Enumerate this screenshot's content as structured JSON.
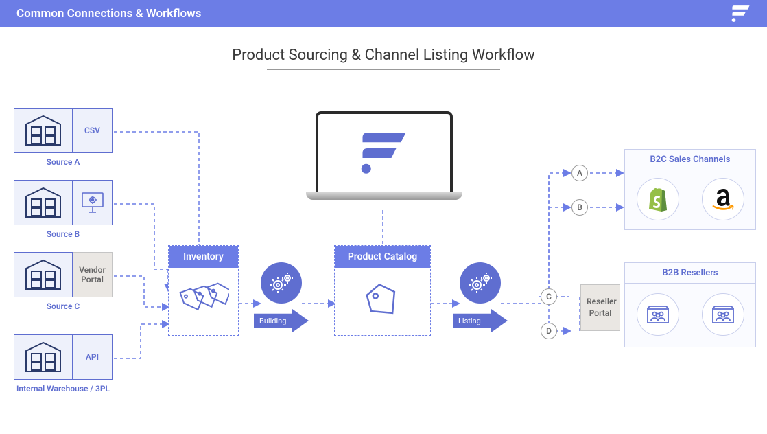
{
  "header": {
    "title": "Common Connections & Workflows"
  },
  "diagram_title": "Product Sourcing & Channel Listing Workflow",
  "sources": [
    {
      "caption": "Source A",
      "tag": "CSV",
      "tag_type": "std"
    },
    {
      "caption": "Source B",
      "tag": "",
      "tag_type": "monitor"
    },
    {
      "caption": "Source C",
      "tag": "Vendor Portal",
      "tag_type": "vendor"
    },
    {
      "caption": "Internal Warehouse / 3PL",
      "tag": "API",
      "tag_type": "std"
    }
  ],
  "inventory": {
    "label": "Inventory"
  },
  "building": {
    "label": "Building"
  },
  "catalog": {
    "label": "Product Catalog"
  },
  "listing": {
    "label": "Listing"
  },
  "letters": [
    "A",
    "B",
    "C",
    "D"
  ],
  "reseller_portal": "Reseller Portal",
  "b2c": {
    "title": "B2C Sales Channels"
  },
  "b2b": {
    "title": "B2B Resellers"
  }
}
